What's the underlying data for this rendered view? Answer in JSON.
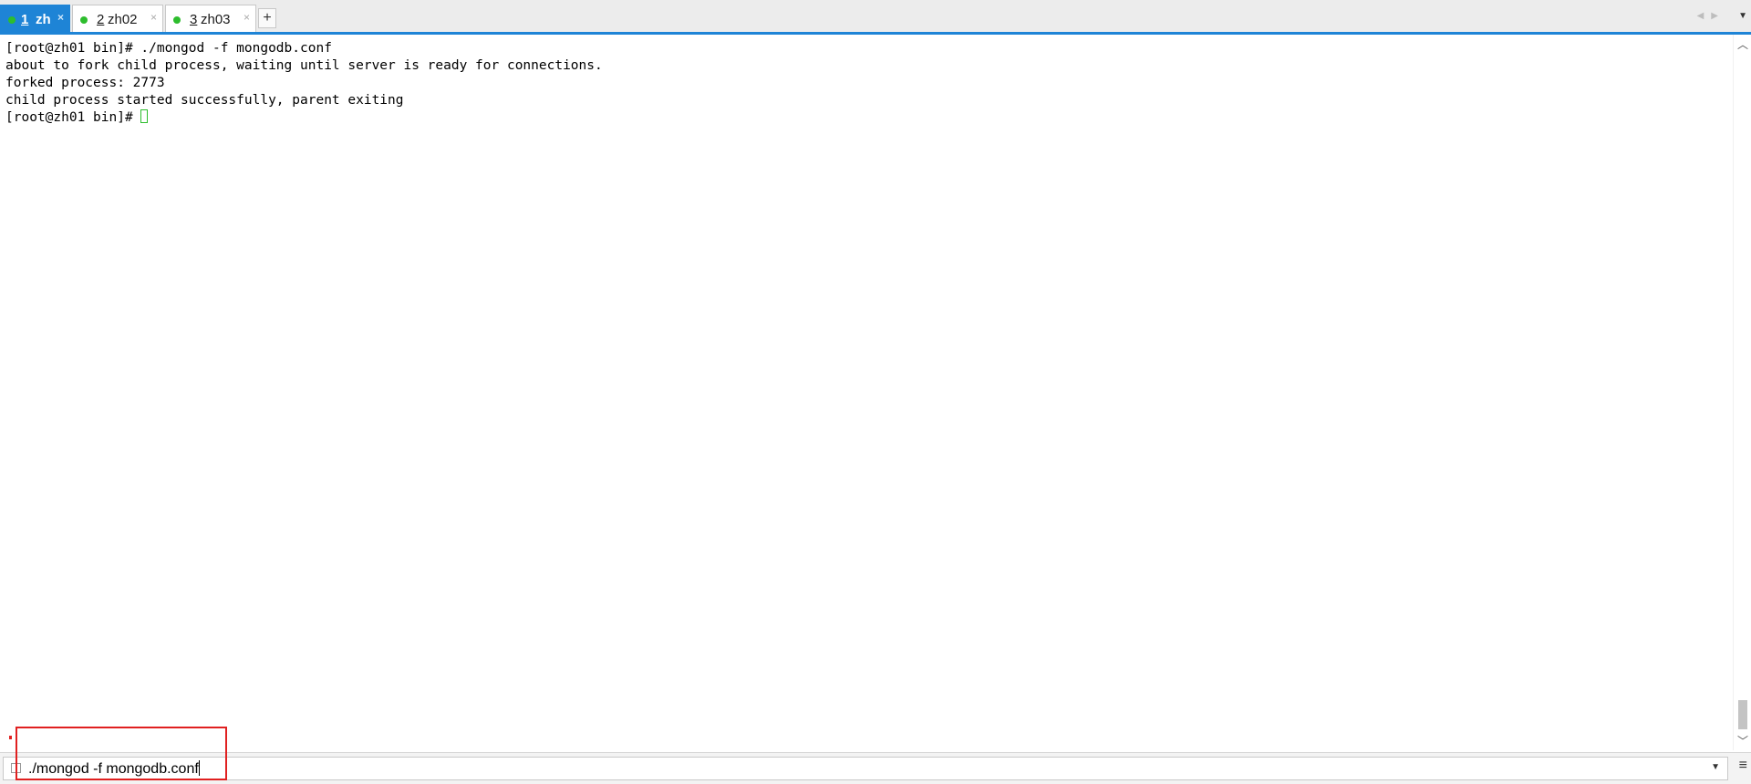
{
  "tabs": [
    {
      "num": "1",
      "name": "zh",
      "close": "×",
      "active": true,
      "status_color": "#2dbd2d"
    },
    {
      "num": "2",
      "name": "zh02",
      "close": "×",
      "active": false,
      "status_color": "#2dbd2d"
    },
    {
      "num": "3",
      "name": "zh03",
      "close": "×",
      "active": false,
      "status_color": "#2dbd2d"
    }
  ],
  "tab_add_label": "+",
  "nav_arrows": "◀▶",
  "tab_menu_icon": "▼",
  "terminal": {
    "lines": [
      "[root@zh01 bin]# ./mongod -f mongodb.conf",
      "about to fork child process, waiting until server is ready for connections.",
      "forked process: 2773",
      "child process started successfully, parent exiting"
    ],
    "prompt": "[root@zh01 bin]# "
  },
  "scrollbar": {
    "up": "︿",
    "down": "﹀"
  },
  "command_bar": {
    "value": "./mongod -f mongodb.conf",
    "dropdown_icon": "▼",
    "menu_icon": "≡"
  },
  "colors": {
    "accent": "#1e84d6",
    "status_connected": "#2dbd2d",
    "highlight": "#e02020"
  }
}
